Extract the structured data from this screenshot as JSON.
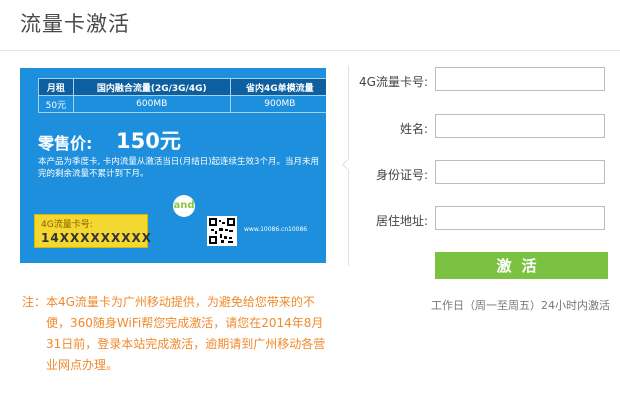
{
  "page": {
    "title": "流量卡激活"
  },
  "card": {
    "table": {
      "headers": [
        "月租",
        "国内融合流量(2G/3G/4G)",
        "省内4G单模流量"
      ],
      "rows": [
        [
          "50元",
          "600MB",
          "900MB"
        ]
      ]
    },
    "price_label": "零售价:",
    "price_value": "150元",
    "description": "本产品为季度卡, 卡内流量从激活当日(月结日)起连续生效3个月。当月未用完的剩余流量不累计到下月。",
    "number_label": "4G流量卡号:",
    "number_value": "14XXXXXXXXX",
    "logo_text": "and",
    "brand_left": "www.10086.cn",
    "brand_right": "10086"
  },
  "form": {
    "fields": [
      {
        "label": "4G流量卡号:",
        "value": ""
      },
      {
        "label": "姓名:",
        "value": ""
      },
      {
        "label": "身份证号:",
        "value": ""
      },
      {
        "label": "居住地址:",
        "value": ""
      }
    ],
    "button_label": "激活",
    "hours_text": "工作日（周一至周五）24小时内激活"
  },
  "note": {
    "prefix": "注：",
    "text": "本4G流量卡为广州移动提供，为避免给您带来的不便，360随身WiFi帮您完成激活，请您在2014年8月31日前，登录本站完成激活，逾期请到广州移动各营业网点办理。"
  },
  "colors": {
    "card_blue": "#1e8fdc",
    "button_green": "#7cc242",
    "note_orange": "#f08a2c",
    "number_yellow": "#f2d830"
  }
}
